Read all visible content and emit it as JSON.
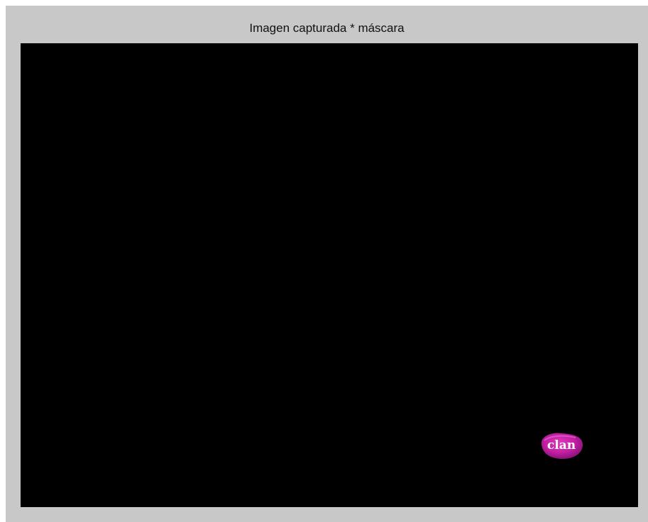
{
  "figure": {
    "title": "Imagen capturada * máscara"
  },
  "image": {
    "background_color": "#000000",
    "logo": {
      "text": "clan",
      "colors": {
        "blob_primary": "#c21fa3",
        "blob_dark": "#8c137a",
        "text": "#ffffff"
      }
    }
  },
  "colors": {
    "window_background": "#c8c8c8",
    "page_background": "#ffffff"
  }
}
